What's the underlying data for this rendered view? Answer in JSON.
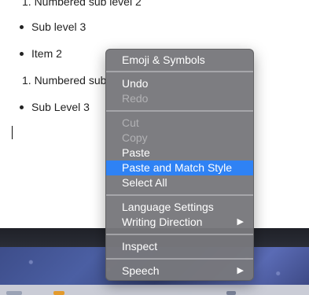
{
  "document": {
    "lines": [
      {
        "text": "1. Numbered sub level 2",
        "type": "numbered"
      },
      {
        "text": "Sub level 3",
        "type": "bullet"
      },
      {
        "text": "Item 2",
        "type": "bullet"
      },
      {
        "text": "1. Numbered sub",
        "type": "numbered"
      },
      {
        "text": "Sub Level 3",
        "type": "bullet"
      }
    ]
  },
  "context_menu": {
    "groups": [
      [
        {
          "label": "Emoji & Symbols",
          "enabled": true
        }
      ],
      [
        {
          "label": "Undo",
          "enabled": true
        },
        {
          "label": "Redo",
          "enabled": false
        }
      ],
      [
        {
          "label": "Cut",
          "enabled": false
        },
        {
          "label": "Copy",
          "enabled": false
        },
        {
          "label": "Paste",
          "enabled": true
        },
        {
          "label": "Paste and Match Style",
          "enabled": true,
          "highlighted": true
        },
        {
          "label": "Select All",
          "enabled": true
        }
      ],
      [
        {
          "label": "Language Settings",
          "enabled": true
        },
        {
          "label": "Writing Direction",
          "enabled": true,
          "submenu": true
        }
      ],
      [
        {
          "label": "Inspect",
          "enabled": true
        }
      ],
      [
        {
          "label": "Speech",
          "enabled": true,
          "submenu": true
        }
      ]
    ],
    "submenu_arrow": "▶",
    "highlight_color": "#2f82f4"
  }
}
